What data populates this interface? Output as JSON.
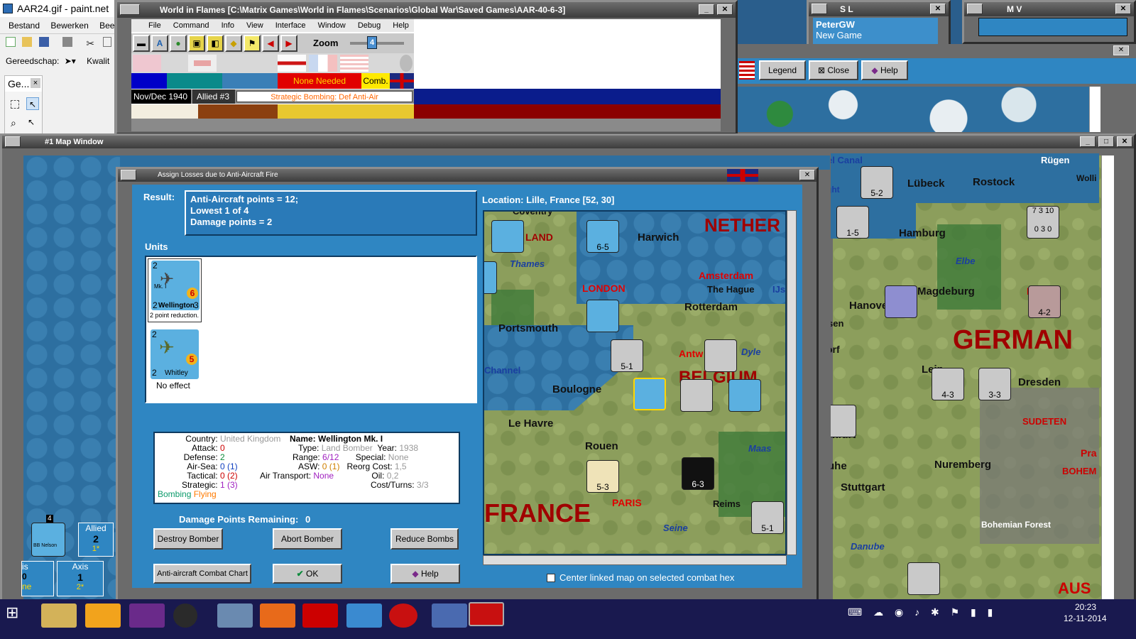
{
  "paint": {
    "title": "AAR24.gif - paint.net",
    "menu": [
      "Bestand",
      "Bewerken",
      "Beeld"
    ],
    "toolbar_label": "Gereedschap:",
    "quality_label": "Kwalit",
    "tools_panel": "Ge...",
    "tools_close": "×"
  },
  "wif": {
    "title": "World in Flames [C:\\Matrix Games\\World in Flames\\Scenarios\\Global War\\Saved Games\\AAR-40-6-3]",
    "menu": [
      "File",
      "Command",
      "Info",
      "View",
      "Interface",
      "Window",
      "Debug",
      "Help"
    ],
    "zoom_label": "Zoom",
    "zoom_value": "4",
    "none_needed": "None Needed",
    "comb": "Comb.",
    "date": "Nov/Dec 1940",
    "impulse": "Allied #3",
    "phase": "Strategic Bombing: Def Anti-Air"
  },
  "sl": {
    "title": "S L",
    "player": "PeterGW",
    "game": "New Game"
  },
  "mv": {
    "title": "M V"
  },
  "legend_bar": {
    "legend": "Legend",
    "close": "Close",
    "help": "Help"
  },
  "mapwin": {
    "title": "#1 Map Window"
  },
  "dialog": {
    "title": "Assign Losses due to Anti-Aircraft Fire",
    "result_label": "Result:",
    "result_lines": [
      "Anti-Aircraft points = 12;",
      "Lowest 1 of 4",
      "Damage points = 2"
    ],
    "units_label": "Units",
    "unit1": {
      "mk": "Mk. I",
      "name": "Wellington",
      "att": "2",
      "def": "2",
      "range": "6",
      "strat": "3",
      "caption": "2 point reduction."
    },
    "unit2": {
      "name": "Whitley",
      "att": "2",
      "def": "2",
      "range": "5",
      "caption": "No effect"
    },
    "location": "Location:  Lille, France [52, 30]",
    "info": {
      "country_label": "Country:",
      "country": "United Kingdom",
      "attack_label": "Attack:",
      "attack": "0",
      "defense_label": "Defense:",
      "defense": "2",
      "airsea_label": "Air-Sea:",
      "airsea": "0 (1)",
      "tactical_label": "Tactical:",
      "tactical": "0 (2)",
      "strategic_label": "Strategic:",
      "strategic": "1 (3)",
      "bombing": "Bombing",
      "flying": "Flying",
      "name_label": "Name:",
      "name": "Wellington Mk. I",
      "type_label": "Type:",
      "type": "Land Bomber",
      "year_label": "Year:",
      "year": "1938",
      "range_label": "Range:",
      "range": "6/12",
      "special_label": "Special:",
      "special": "None",
      "asw_label": "ASW:",
      "asw": "0 (1)",
      "reorg_label": "Reorg Cost:",
      "reorg": "1,5",
      "airtrans_label": "Air Transport:",
      "airtrans": "None",
      "oil_label": "Oil:",
      "oil": "0,2",
      "cost_label": "Cost/Turns:",
      "cost": "3/3"
    },
    "damage_label": "Damage Points Remaining:",
    "damage_value": "0",
    "destroy": "Destroy Bomber",
    "abort": "Abort Bomber",
    "reduce": "Reduce Bombs",
    "aa_chart": "Anti-aircraft Combat Chart",
    "ok": "OK",
    "help": "Help",
    "center_check": "Center linked map on selected combat hex"
  },
  "minimap": {
    "places": [
      "NETHER",
      "Harwich",
      "LONDON",
      "Thames",
      "Amsterdam",
      "The Hague",
      "IJs",
      "Rotterdam",
      "Portsmouth",
      "Antw",
      "Dyle",
      "Channel",
      "Boulogne",
      "BELGIUM",
      "Le Havre",
      "Rouen",
      "Maas",
      "PARIS",
      "Reims",
      "Seine",
      "FRANCE",
      "LAND",
      "Coventry"
    ],
    "counters": [
      "6-5",
      "5-1",
      "6-3",
      "5-3",
      "5-1"
    ]
  },
  "bigmap": {
    "places": [
      "Kiel Canal",
      "Rügen",
      "Bight",
      "Lübeck",
      "Rostock",
      "Wolli",
      "Hamburg",
      "Elbe",
      "Hanover",
      "Magdeburg",
      "BE",
      "GERMAN",
      "orf",
      "Leip",
      "Dresden",
      "kfurt",
      "SUDETEN",
      "uhe",
      "Nuremberg",
      "Pra",
      "BOHEM",
      "Stuttgart",
      "Bohemian Forest",
      "Danube",
      "AUS",
      "sen"
    ],
    "counters": [
      "5-2",
      "1-5",
      "4-2",
      "4-3",
      "3-3",
      "7 3 10",
      "0 3 0"
    ]
  },
  "side": {
    "allied": "Allied",
    "allied_num": "2",
    "allied_sub": "1*",
    "axis": "Axis",
    "axis_num": "1",
    "axis_sub": "2*",
    "bb": "BB Nelson",
    "counter_top": "4",
    "is_label": "is",
    "ne_label": "ne",
    "zero": "0"
  },
  "clock": {
    "time": "20:23",
    "date": "12-11-2014"
  },
  "colors": {
    "dialog_blue": "#2f86c2",
    "result_blue": "#2a7ab8",
    "map_sea": "#2d6fa0",
    "taskbar": "#19194f"
  }
}
